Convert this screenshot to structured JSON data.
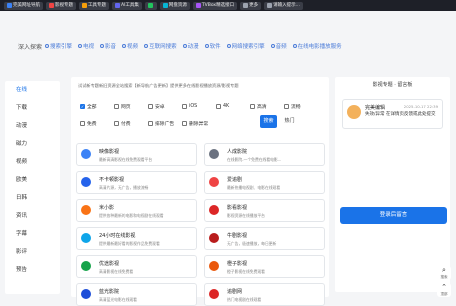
{
  "topbar": {
    "items": [
      {
        "label": "完美网址导航",
        "color": "#3b82f6"
      },
      {
        "label": "影视专题",
        "color": "#ef4444"
      },
      {
        "label": "工具专题",
        "color": "#f59e0b"
      },
      {
        "label": "AI工具集",
        "color": "#6366f1"
      },
      {
        "label": "",
        "color": "#22c55e"
      },
      {
        "label": "网盘资源",
        "color": "#06b6d4"
      },
      {
        "label": "TVBox精选接口",
        "color": "#a855f7"
      },
      {
        "label": "更多",
        "color": "#9ca3af"
      },
      {
        "label": "请输入提示...",
        "color": "#9ca3af"
      }
    ]
  },
  "nav": {
    "title": "深入探索",
    "links": [
      "搜索引擎",
      "电视",
      "影音",
      "视频",
      "互联网搜索",
      "动漫",
      "软件",
      "网络搜索引擎",
      "音频",
      "在线电影播放服务"
    ]
  },
  "sidebar": {
    "items": [
      "在线",
      "下载",
      "动漫",
      "磁力",
      "视频",
      "欧美",
      "日韩",
      "资讯",
      "字幕",
      "影评",
      "预告"
    ]
  },
  "main": {
    "notice": "试试新专题新旧资源全站搜索【新导航广告更新】提供更多在线影视播放资源/影视专题",
    "options": [
      {
        "label": "全部",
        "checked": true
      },
      {
        "label": "网页",
        "checked": false
      },
      {
        "label": "安卓",
        "checked": false
      },
      {
        "label": "iOS",
        "checked": false
      },
      {
        "label": "4K",
        "checked": false
      },
      {
        "label": "高清",
        "checked": false
      },
      {
        "label": "流畅",
        "checked": false
      },
      {
        "label": "免费",
        "checked": false
      },
      {
        "label": "付费",
        "checked": false
      },
      {
        "label": "排除广告",
        "checked": false
      },
      {
        "label": "删除异常",
        "checked": false
      }
    ],
    "search_label": "搜索",
    "hot_label": "热门",
    "sites": [
      {
        "name": "映像影视",
        "desc": "最新高清影视在线免费观看平台",
        "color": "#3b82f6"
      },
      {
        "name": "人成影院",
        "desc": "在线影院-一个免费在线看电影...",
        "color": "#6b7280"
      },
      {
        "name": "不卡顿影视",
        "desc": "高清片源，无广告，播放流畅",
        "color": "#2563eb"
      },
      {
        "name": "爱追剧",
        "desc": "最新热播电视剧、电影在线观看",
        "color": "#ef4444"
      },
      {
        "name": "米小影",
        "desc": "提供各种最新的电影和电视剧在线观看",
        "color": "#f97316"
      },
      {
        "name": "影看影视",
        "desc": "影视资源在线播放平台",
        "color": "#dc2626"
      },
      {
        "name": "24小时在线影视",
        "desc": "提供最新最好看的影视作品免费观看",
        "color": "#0ea5e9"
      },
      {
        "name": "牛剧影视",
        "desc": "无广告，极速播放，每日更新",
        "color": "#b91c1c"
      },
      {
        "name": "优途影视",
        "desc": "高清影视在线免费看",
        "color": "#16a34a"
      },
      {
        "name": "橙子影视",
        "desc": "橙子影视在线免费观看",
        "color": "#ea580c"
      },
      {
        "name": "蓝光影院",
        "desc": "高清蓝光电影在线观看",
        "color": "#1d4ed8"
      },
      {
        "name": "追剧网",
        "desc": "热门电视剧在线观看",
        "color": "#dc2626"
      }
    ]
  },
  "right": {
    "title": "影视专题 · 留言板",
    "feed": {
      "name": "完美编辑",
      "time": "2025-10-17 22:39",
      "message": "失效/异常 在详情页反馈或此处提交"
    },
    "login_label": "登录后留言"
  },
  "float": {
    "search_label": "搜索",
    "top_label": "顶部"
  }
}
